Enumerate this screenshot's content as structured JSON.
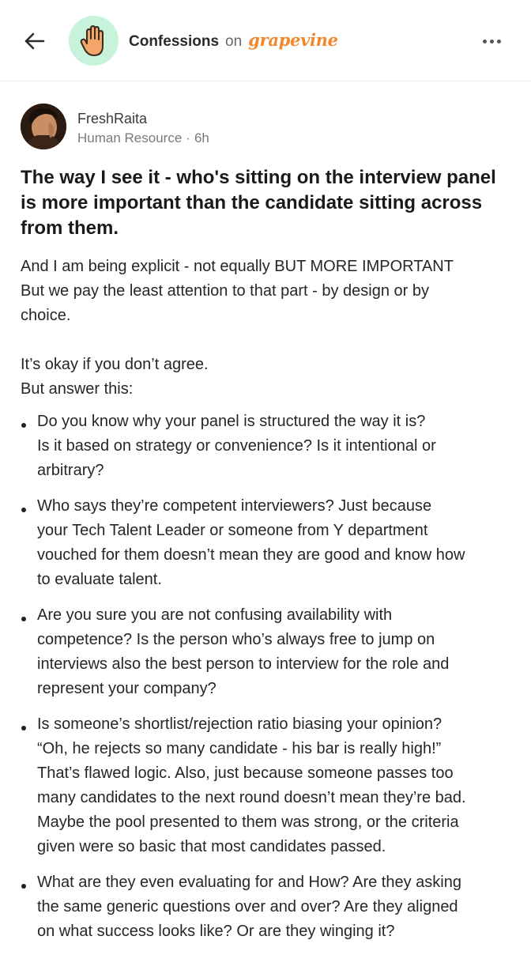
{
  "header": {
    "title": "Confessions",
    "on": "on",
    "brand": "grapevine",
    "back_icon": "arrow-left-icon",
    "logo_icon": "raised-hand-icon",
    "more_icon": "more-horizontal-icon",
    "brand_color": "#f0892d",
    "logo_bg": "#c7f2dc"
  },
  "post": {
    "author": "FreshRaita",
    "department": "Human Resource",
    "separator": "·",
    "time": "6h",
    "title": "The way I see it - who's sitting on the interview panel is more important than the candidate sitting across from them.",
    "intro_lines": [
      "And I am being explicit - not equally BUT MORE IMPORTANT",
      "But we pay the least attention to that part - by design or by",
      "choice."
    ],
    "intro2_lines": [
      "It’s okay if you don’t agree.",
      "But answer this:"
    ],
    "bullets": [
      [
        "Do you know why your panel is structured the way it is?",
        "Is it based on strategy or convenience? Is it intentional or",
        "arbitrary?"
      ],
      [
        "Who says they’re competent interviewers? Just because",
        "your Tech Talent Leader or someone from Y department",
        "vouched for them doesn’t mean they are good and know how",
        "to evaluate talent."
      ],
      [
        "Are you sure you are not confusing availability with",
        "competence? Is the person who’s always free to jump on",
        "interviews also the best person to interview for the role and",
        "represent your company?"
      ],
      [
        "Is someone’s shortlist/rejection ratio biasing your opinion?",
        "“Oh, he rejects so many candidate - his bar is really high!”",
        "That’s flawed logic. Also, just because someone passes too",
        "many candidates to the next round doesn’t mean they’re bad.",
        "Maybe the pool presented to them was strong, or the criteria",
        "given were so basic that most candidates passed."
      ],
      [
        "What are they even evaluating for and How? Are they asking",
        "the same generic questions over and over? Are they aligned",
        "on what success looks like? Or are they winging it?"
      ]
    ]
  }
}
